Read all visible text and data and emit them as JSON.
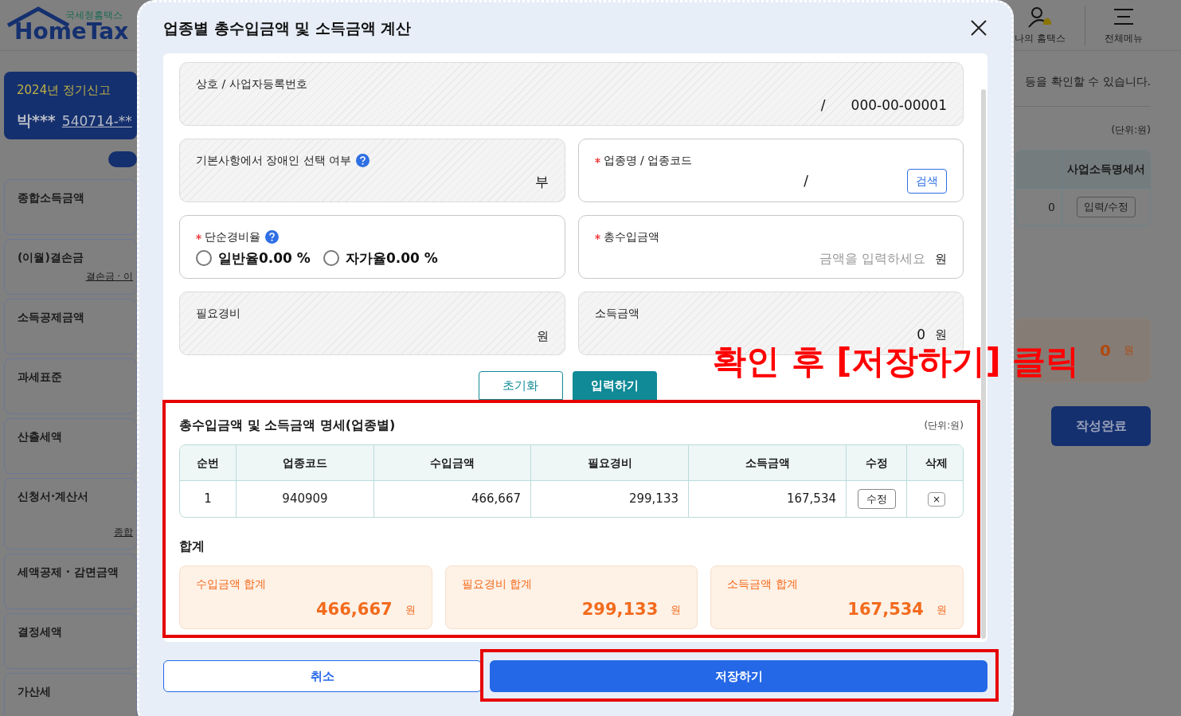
{
  "background": {
    "logo": {
      "agency": "국세청홈택스",
      "name": "HomeTax"
    },
    "header_menu": [
      {
        "kind": "user",
        "label": "나의 홈택스"
      },
      {
        "kind": "menu",
        "label": "전체메뉴"
      }
    ],
    "filing_card": {
      "title": "2024년 정기신고",
      "name": "박***",
      "id": "540714-**"
    },
    "toggle": {
      "on": true
    },
    "sidebar": {
      "items": [
        {
          "label": "종합소득금액"
        },
        {
          "label": "(이월)결손금",
          "links": [
            "결손금 · 이"
          ]
        },
        {
          "label": "소득공제금액"
        },
        {
          "label": "과세표준"
        },
        {
          "label": "산출세액"
        },
        {
          "label": "신청서·계산서",
          "links": [
            "종합"
          ]
        },
        {
          "label": "세액공제 · 감면금액"
        },
        {
          "label": "결정세액"
        },
        {
          "label": "가산세"
        }
      ]
    },
    "notice": "등을 확인할 수 있습니다.",
    "unit": "(단위:원)",
    "table": {
      "column": "사업소득명세서",
      "cell": "0",
      "button": "입력/수정"
    },
    "total": {
      "value": "0",
      "unit": "원"
    },
    "complete_button": "작성완료"
  },
  "modal": {
    "title": "업종별 총수입금액 및 소득금액 계산",
    "form": {
      "rows": [
        [
          {
            "kind": "readonly",
            "label": "상호 / 사업자등록번호",
            "values": [
              "/",
              "000-00-00001"
            ]
          }
        ],
        [
          {
            "kind": "readonly",
            "label": "기본사항에서 장애인 선택 여부",
            "help": true,
            "values": [
              "부"
            ]
          },
          {
            "kind": "search",
            "label": "업종명 / 업종코드",
            "required": true,
            "values": [
              "/"
            ],
            "button": "검색"
          }
        ],
        [
          {
            "kind": "radio",
            "label": "단순경비율",
            "required": true,
            "help": true,
            "options": [
              {
                "label": "일반율0.00 %",
                "selected": false
              },
              {
                "label": "자가율0.00 %",
                "selected": false
              }
            ]
          },
          {
            "kind": "input",
            "label": "총수입금액",
            "required": true,
            "placeholder": "금액을 입력하세요",
            "unit": "원"
          }
        ],
        [
          {
            "kind": "readonly",
            "label": "필요경비",
            "unit": "원"
          },
          {
            "kind": "readonly",
            "label": "소득금액",
            "values": [
              "0"
            ],
            "unit": "원"
          }
        ]
      ]
    },
    "actions": [
      {
        "kind": "outline",
        "label": "초기화"
      },
      {
        "kind": "filled",
        "label": "입력하기"
      }
    ],
    "detail": {
      "title": "총수입금액 및 소득금액 명세(업종별)",
      "unit": "(단위:원)",
      "columns": [
        "순번",
        "업종코드",
        "수입금액",
        "필요경비",
        "소득금액",
        "수정",
        "삭제"
      ],
      "rows": [
        {
          "no": "1",
          "code": "940909",
          "revenue": "466,667",
          "expense": "299,133",
          "income": "167,534",
          "edit": "수정",
          "delete": "×"
        }
      ]
    },
    "summary": {
      "title": "합계",
      "cards": [
        {
          "label": "수입금액 합계",
          "value": "466,667",
          "unit": "원"
        },
        {
          "label": "필요경비 합계",
          "value": "299,133",
          "unit": "원"
        },
        {
          "label": "소득금액 합계",
          "value": "167,534",
          "unit": "원"
        }
      ]
    },
    "footer": [
      {
        "kind": "cancel",
        "label": "취소"
      },
      {
        "kind": "save",
        "label": "저장하기"
      }
    ]
  },
  "annotation": {
    "text": "확인 후 [저장하기] 클릭"
  }
}
